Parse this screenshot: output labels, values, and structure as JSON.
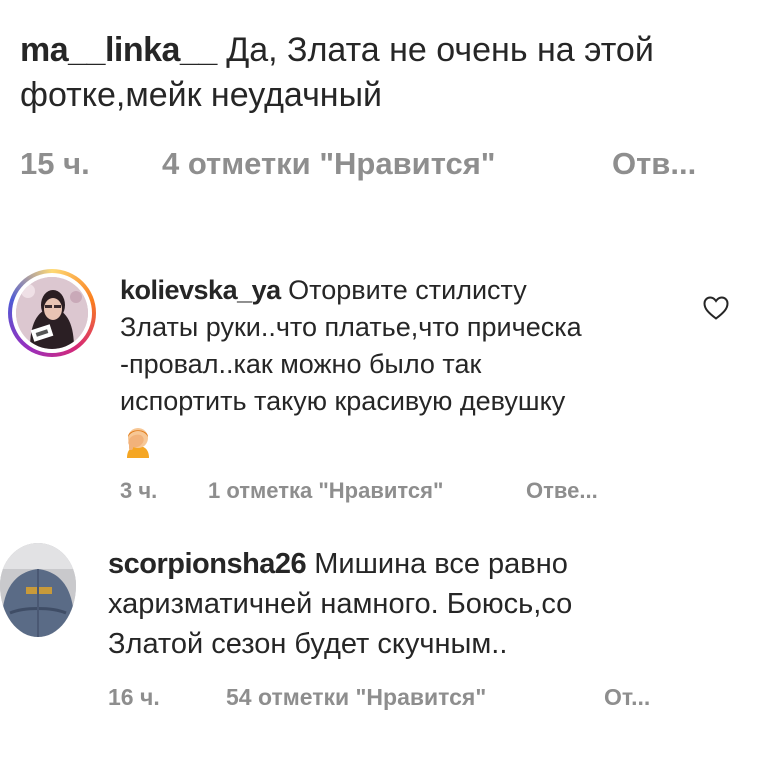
{
  "comments": [
    {
      "username": "ma__linka__",
      "text": "Да, Злата не очень на этой фотке,мейк неудачный",
      "time": "15 ч.",
      "likes": "4 отметки \"Нравится\"",
      "reply": "Отв..."
    },
    {
      "username": "kolievska_ya",
      "text_lines": [
        "Оторвите стилисту",
        "Златы руки..что платье,что прическа",
        "-провал..как можно было так",
        "испортить такую красивую девушку"
      ],
      "emoji_icon": "facepalm-emoji-icon",
      "time": "3 ч.",
      "likes": "1 отметка \"Нравится\"",
      "reply": "Отве..."
    },
    {
      "username": "scorpionsha26",
      "text_lines": [
        "Мишина все равно",
        "харизматичней намного. Боюсь,со",
        "Златой сезон будет скучным.."
      ],
      "time": "16 ч.",
      "likes": "54 отметки \"Нравится\"",
      "reply": "От..."
    }
  ],
  "colors": {
    "text": "#262626",
    "meta": "#8e8e8e",
    "story_ring": [
      "#feda75",
      "#fa7e1e",
      "#d62976",
      "#962fbf",
      "#4f5bd5"
    ]
  },
  "icons": [
    "heart-icon",
    "facepalm-emoji-icon"
  ]
}
